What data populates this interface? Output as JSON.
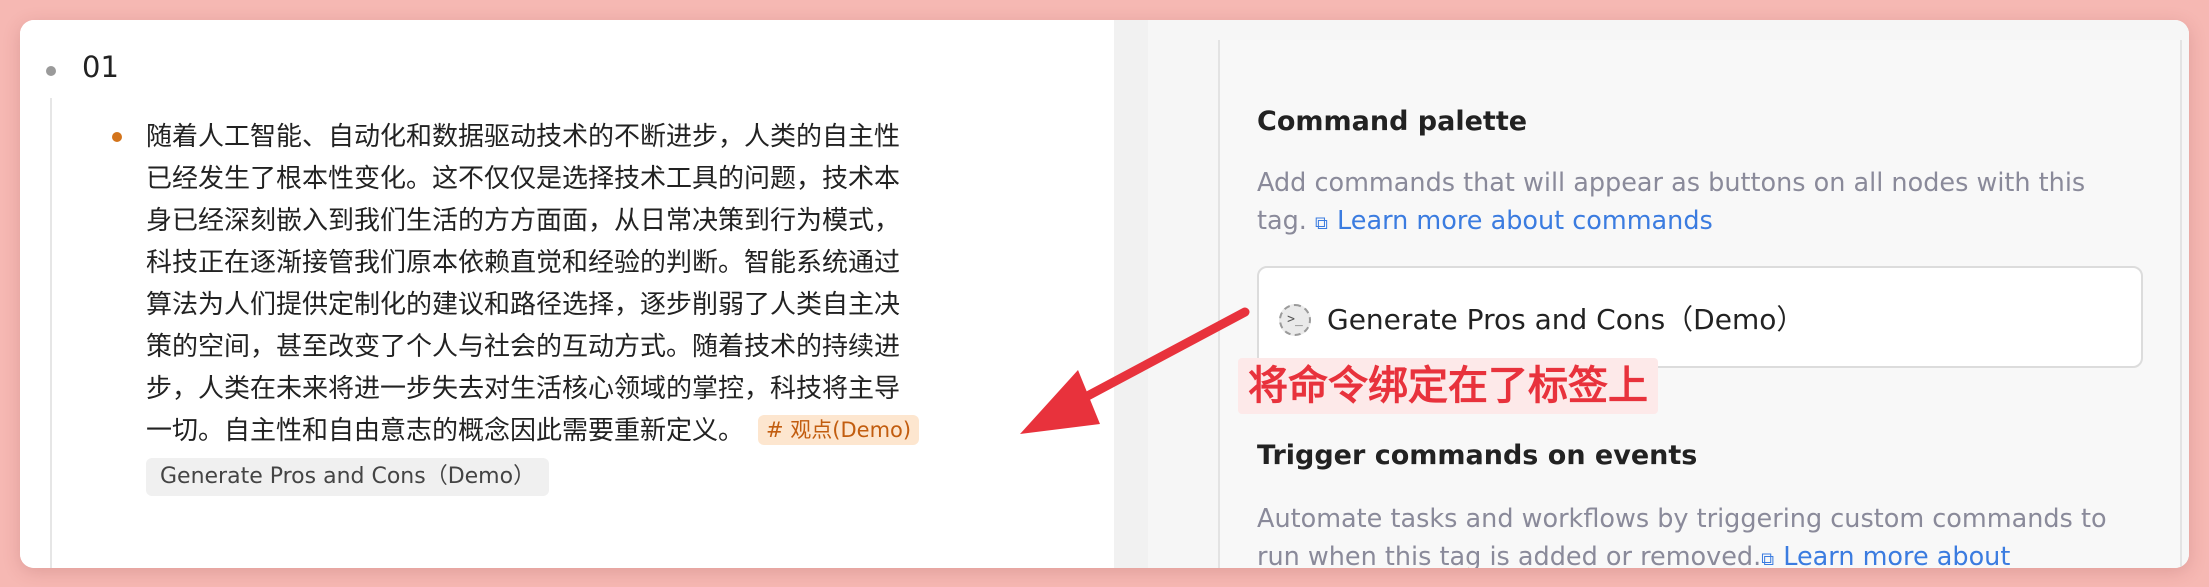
{
  "outline": {
    "parent_node": "01",
    "paragraph_lines": [
      "随着人工智能、自动化和数据驱动技术的不断进步，人类的自主性",
      "已经发生了根本性变化。这不仅仅是选择技术工具的问题，技术本",
      "身已经深刻嵌入到我们生活的方方面面，从日常决策到行为模式，",
      "科技正在逐渐接管我们原本依赖直觉和经验的判断。智能系统通过",
      "算法为人们提供定制化的建议和路径选择，逐步削弱了人类自主决",
      "策的空间，甚至改变了个人与社会的互动方式。随着技术的持续进",
      "步，人类在未来将进一步失去对生活核心领域的掌控，科技将主导",
      "一切。自主性和自由意志的概念因此需要重新定义。"
    ],
    "tag": "# 观点(Demo)",
    "command_button": "Generate Pros and Cons（Demo）"
  },
  "panel": {
    "command_palette": {
      "title": "Command palette",
      "description": "Add commands that will appear as buttons on all nodes with this",
      "description_2": "tag.",
      "link": "Learn more about commands",
      "command": "Generate Pros and Cons（Demo）",
      "command_icon": "terminal-icon"
    },
    "triggers": {
      "title": "Trigger commands on events",
      "description": "Automate tasks and workflows by triggering custom commands to",
      "description_2": "run when this tag is added or removed.",
      "link": "Learn more about"
    }
  },
  "annotation": "将命令绑定在了标签上",
  "colors": {
    "background": "#f6b8b3",
    "tag_bg": "#fde6cf",
    "tag_text": "#c25d0f",
    "link": "#3b7ce0",
    "annotation": "#e8323c"
  }
}
